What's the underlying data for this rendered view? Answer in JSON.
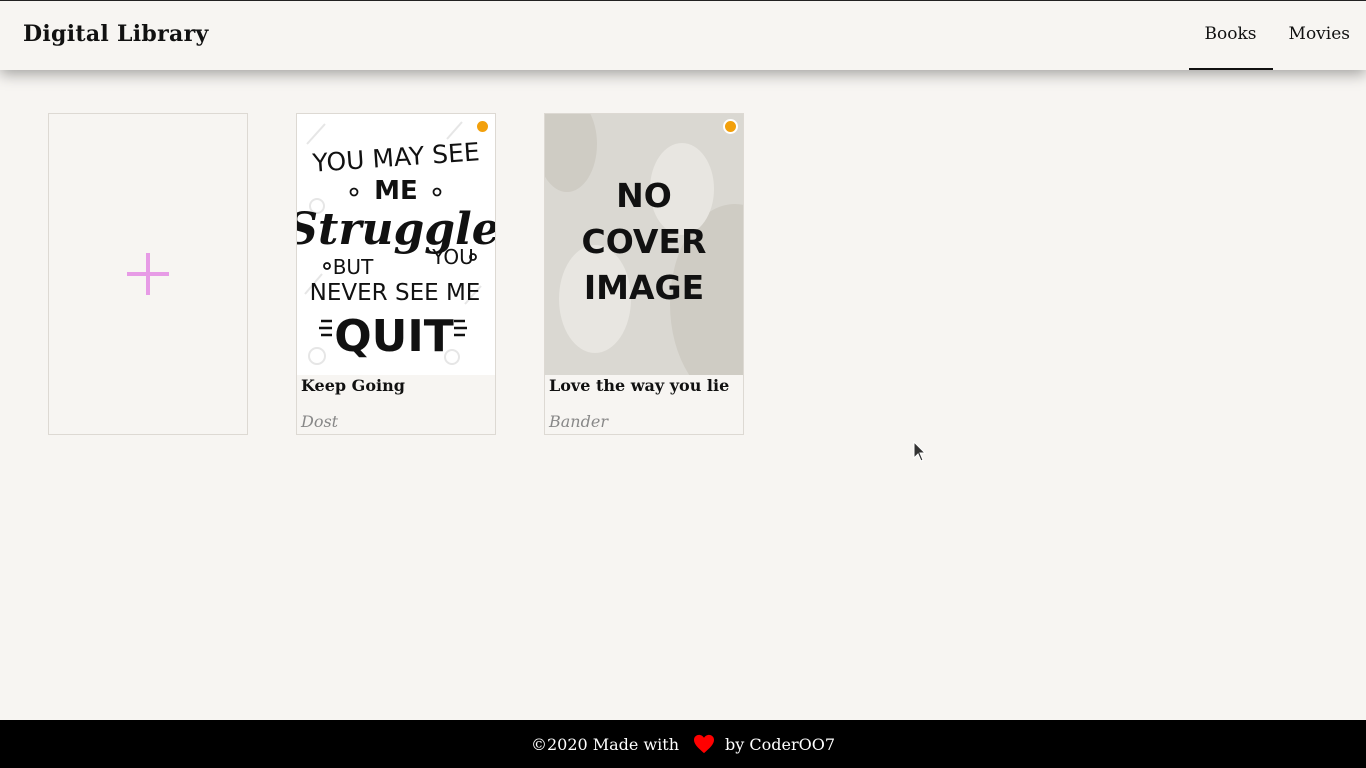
{
  "header": {
    "brand": "Digital Library",
    "nav": [
      {
        "label": "Books",
        "active": true
      },
      {
        "label": "Movies",
        "active": false
      }
    ]
  },
  "library": {
    "add_icon": "plus-icon",
    "books": [
      {
        "title": "Keep Going",
        "author": "Dost",
        "cover_lines": [
          "YOU MAY SEE",
          "ME",
          "Struggle",
          "YOU",
          "BUT",
          "NEVER SEE ME",
          "QUIT"
        ],
        "status_color": "#f2a00c"
      },
      {
        "title": "Love the way you lie",
        "author": "Bander",
        "cover_lines": [
          "NO",
          "COVER",
          "IMAGE"
        ],
        "status_color": "#f2a00c"
      }
    ]
  },
  "footer": {
    "prefix": "©2020 Made with",
    "heart_icon": "heart-icon",
    "suffix": "by CoderOO7"
  }
}
